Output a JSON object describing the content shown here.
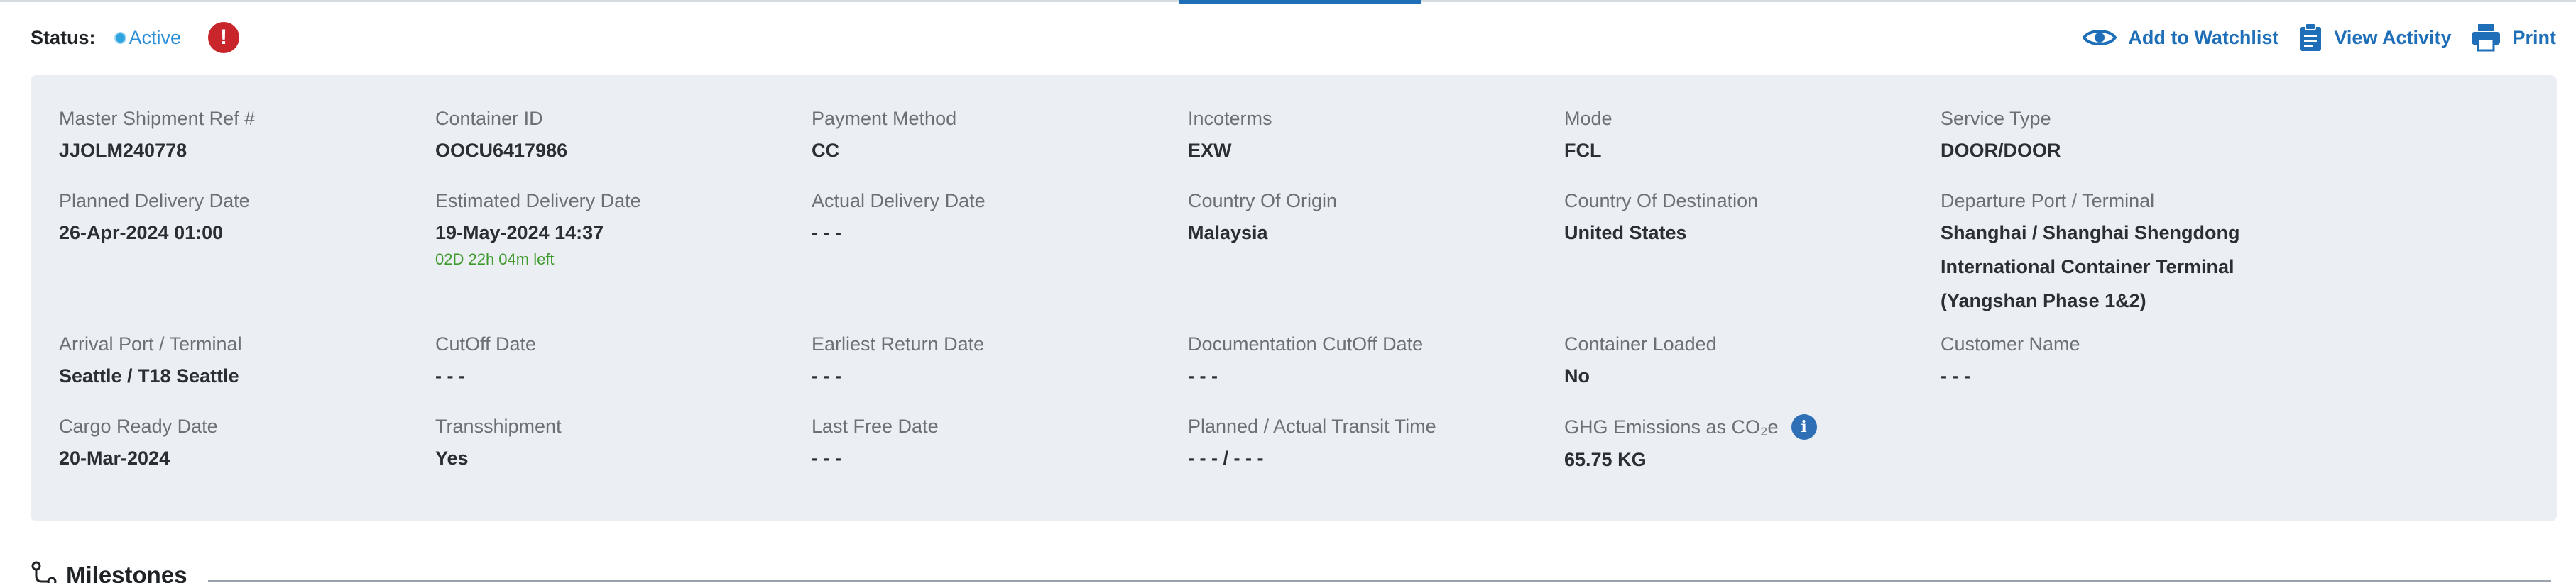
{
  "status": {
    "label": "Status:",
    "value": "Active",
    "alert_symbol": "!"
  },
  "actions": [
    {
      "label": "Add to Watchlist",
      "icon": "eye-icon"
    },
    {
      "label": "View Activity",
      "icon": "clipboard-icon"
    },
    {
      "label": "Print",
      "icon": "printer-icon"
    }
  ],
  "details": [
    {
      "label": "Master Shipment Ref #",
      "value": "JJOLM240778"
    },
    {
      "label": "Container ID",
      "value": "OOCU6417986"
    },
    {
      "label": "Payment Method",
      "value": "CC"
    },
    {
      "label": "Incoterms",
      "value": "EXW"
    },
    {
      "label": "Mode",
      "value": "FCL"
    },
    {
      "label": "Service Type",
      "value": "DOOR/DOOR"
    },
    {
      "label": "Planned Delivery Date",
      "value": "26-Apr-2024 01:00"
    },
    {
      "label": "Estimated Delivery Date",
      "value": "19-May-2024 14:37",
      "sub": "02D 22h 04m left"
    },
    {
      "label": "Actual Delivery Date",
      "value": "- - -"
    },
    {
      "label": "Country Of Origin",
      "value": "Malaysia"
    },
    {
      "label": "Country Of Destination",
      "value": "United States"
    },
    {
      "label": "Departure Port / Terminal",
      "value": "Shanghai / Shanghai Shengdong International Container Terminal (Yangshan Phase 1&2)"
    },
    {
      "label": "Arrival Port / Terminal",
      "value": "Seattle / T18 Seattle"
    },
    {
      "label": "CutOff Date",
      "value": "- - -"
    },
    {
      "label": "Earliest Return Date",
      "value": "- - -"
    },
    {
      "label": "Documentation CutOff Date",
      "value": "- - -"
    },
    {
      "label": "Container Loaded",
      "value": "No"
    },
    {
      "label": "Customer Name",
      "value": "- - -"
    },
    {
      "label": "Cargo Ready Date",
      "value": "20-Mar-2024"
    },
    {
      "label": "Transshipment",
      "value": "Yes"
    },
    {
      "label": "Last Free Date",
      "value": "- - -"
    },
    {
      "label": "Planned / Actual Transit Time",
      "value": "- - - / - - -"
    },
    {
      "label": "GHG Emissions as CO₂e",
      "value": "65.75 KG",
      "info": "i"
    }
  ],
  "milestones": {
    "title": "Milestones"
  },
  "colors": {
    "accent": "#1f6fb8",
    "active": "#2a8fd8",
    "alert": "#c8262b",
    "panel": "#ebeff3",
    "time_left": "#3f9a2e"
  }
}
